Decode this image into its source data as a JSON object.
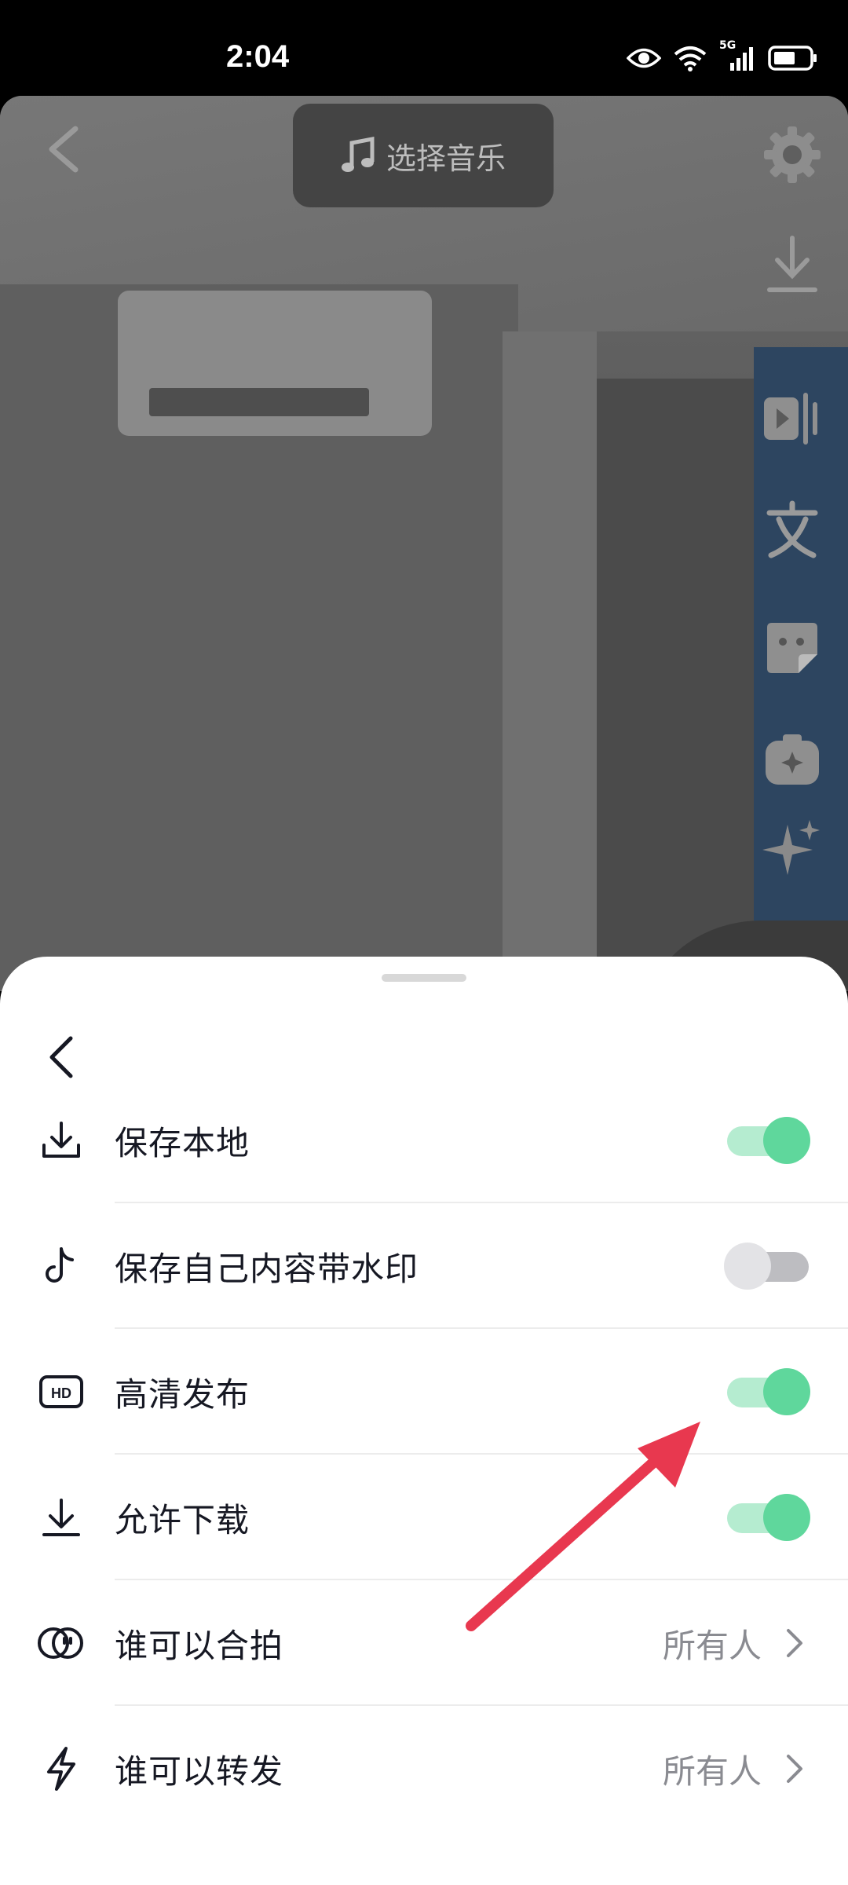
{
  "status_bar": {
    "time": "2:04",
    "network": "5G"
  },
  "top_bar": {
    "music_label": "选择音乐"
  },
  "right_tools": [
    "gear-icon",
    "download-icon",
    "split-icon",
    "text-icon",
    "sticker-icon",
    "effects-icon",
    "sparkle-icon"
  ],
  "sheet": {
    "rows": [
      {
        "icon": "download-icon",
        "label": "保存本地",
        "toggle": true
      },
      {
        "icon": "tiktok-icon",
        "label": "保存自己内容带水印",
        "toggle": false
      },
      {
        "icon": "hd-icon",
        "label": "高清发布",
        "toggle": true
      },
      {
        "icon": "download-icon",
        "label": "允许下载",
        "toggle": true
      },
      {
        "icon": "duet-icon",
        "label": "谁可以合拍",
        "value": "所有人"
      },
      {
        "icon": "lightning-icon",
        "label": "谁可以转发",
        "value": "所有人"
      }
    ]
  },
  "colors": {
    "toggle_on": "#5fd79c",
    "toggle_off": "#bdbdc1",
    "arrow": "#e8384f"
  }
}
